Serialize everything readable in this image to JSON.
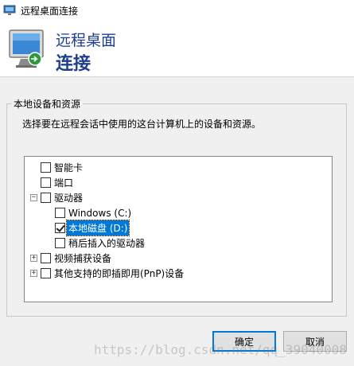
{
  "window": {
    "title": "远程桌面连接"
  },
  "banner": {
    "line1": "远程桌面",
    "line2": "连接"
  },
  "group": {
    "label": "本地设备和资源",
    "instruction": "选择要在远程会话中使用的这台计算机上的设备和资源。"
  },
  "tree": {
    "smartcard": "智能卡",
    "ports": "端口",
    "drives": "驱动器",
    "drive_c": "Windows (C:)",
    "drive_d": "本地磁盘 (D:)",
    "later_drives": "稍后插入的驱动器",
    "video_capture": "视频捕获设备",
    "pnp": "其他支持的即插即用(PnP)设备",
    "states": {
      "smartcard_checked": false,
      "ports_checked": false,
      "drives_checked": false,
      "drive_c_checked": false,
      "drive_d_checked": true,
      "later_drives_checked": false,
      "video_capture_checked": false,
      "pnp_checked": false,
      "drives_expanded": true,
      "selected_item": "本地磁盘 (D:)"
    }
  },
  "buttons": {
    "ok": "确定",
    "cancel": "取消"
  },
  "watermark": "https://blog.csdn.net/qq_39040008",
  "colors": {
    "banner_text": "#1e3f8f",
    "selection": "#0078d7"
  },
  "icons": {
    "app": "remote-desktop-icon",
    "banner": "remote-desktop-icon"
  }
}
